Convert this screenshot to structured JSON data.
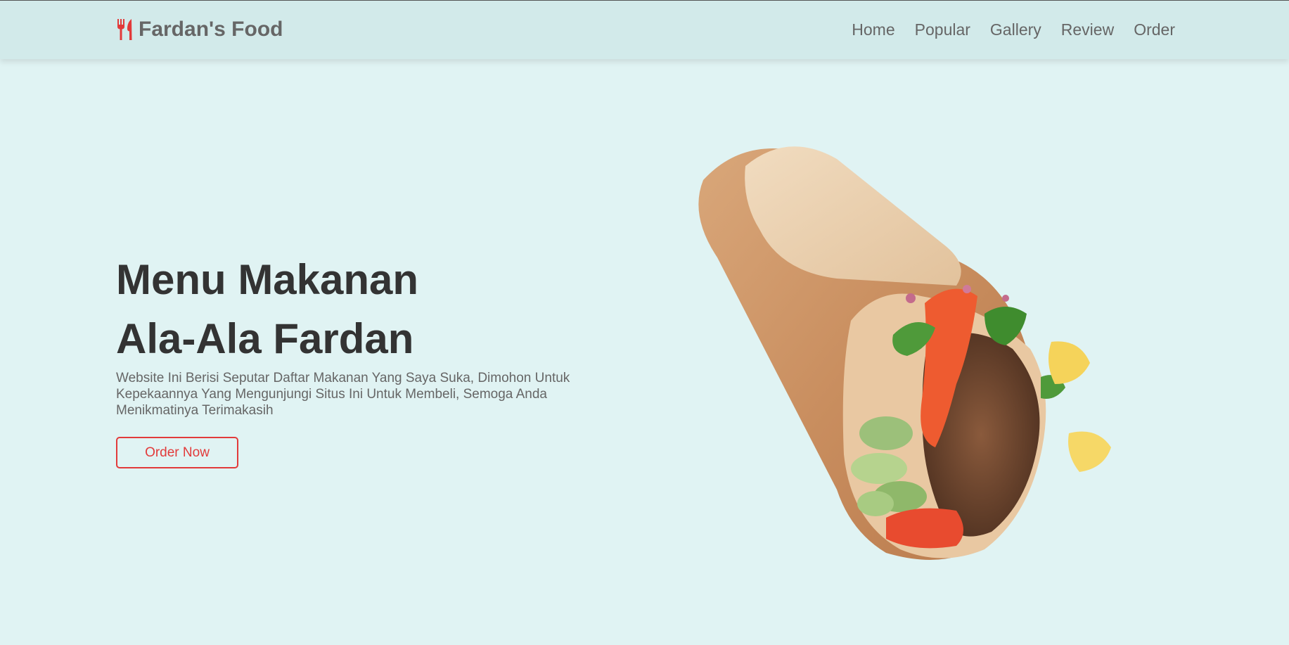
{
  "brand": {
    "name": "Fardan's Food",
    "icon": "utensils-icon",
    "accent_color": "#e23a3a"
  },
  "nav": {
    "items": [
      {
        "label": "Home"
      },
      {
        "label": "Popular"
      },
      {
        "label": "Gallery"
      },
      {
        "label": "Review"
      },
      {
        "label": "Order"
      }
    ]
  },
  "hero": {
    "title_line1": "Menu Makanan",
    "title_line2": "Ala-Ala Fardan",
    "description": "Website Ini Berisi Seputar Daftar Makanan Yang Saya Suka, Dimohon Untuk Kepekaannya Yang Mengunjungi Situs Ini Untuk Membeli, Semoga Anda Menikmatinya Terimakasih",
    "cta_label": "Order Now",
    "image": "kebab-wrap-image"
  },
  "colors": {
    "background": "#e0f3f3",
    "header_background": "#d2eaea",
    "title_text": "#333333",
    "body_text": "#666666"
  }
}
